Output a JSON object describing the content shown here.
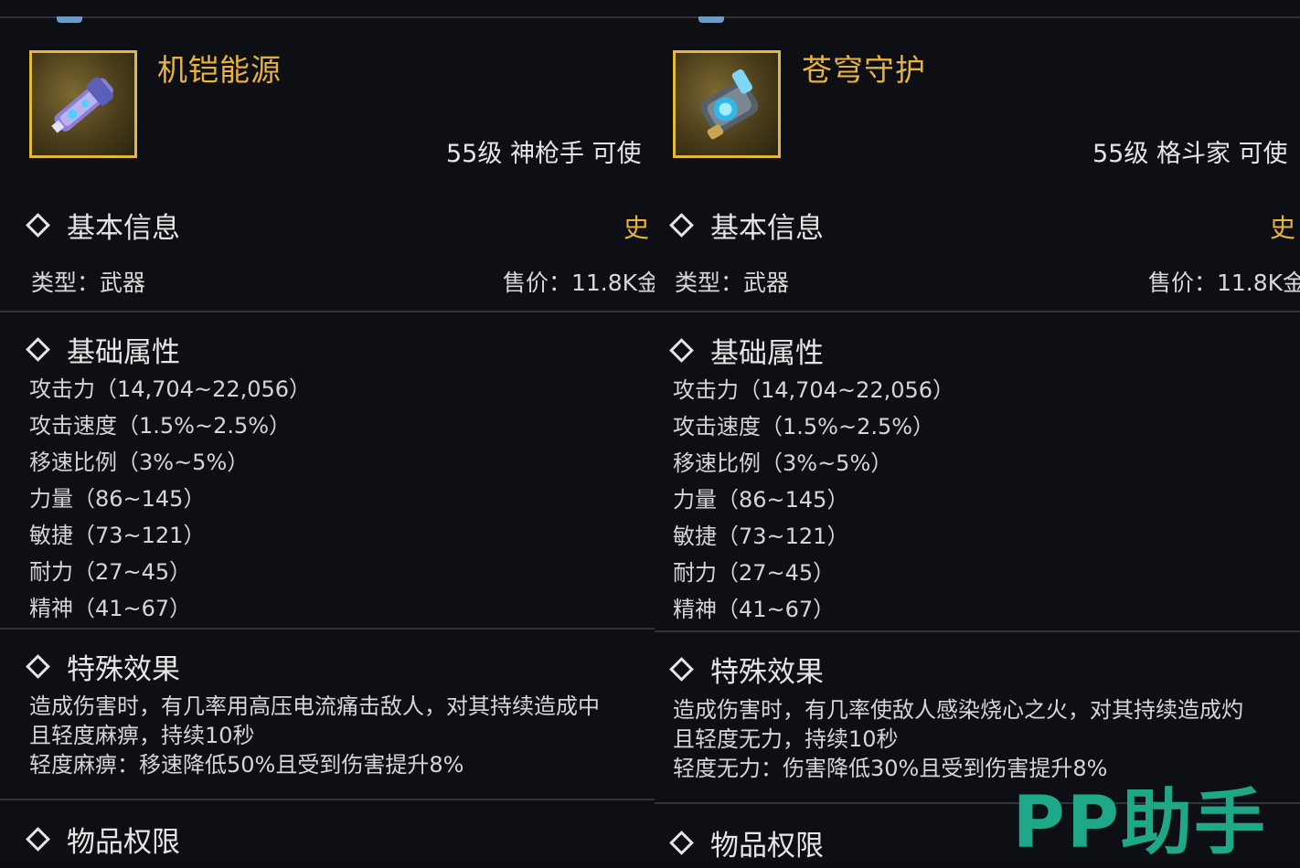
{
  "items": [
    {
      "name": "机铠能源",
      "requirement": "55级 神枪手 可使",
      "rarity": "史",
      "basic_info_title": "基本信息",
      "type_text": "类型：武器",
      "price_text": "售价：11.8K金",
      "attributes_title": "基础属性",
      "attributes": [
        "攻击力（14,704~22,056）",
        "攻击速度（1.5%~2.5%）",
        "移速比例（3%~5%）",
        "力量（86~145）",
        "敏捷（73~121）",
        "耐力（27~45）",
        "精神（41~67）"
      ],
      "effects_title": "特殊效果",
      "effect_lines": [
        "造成伤害时，有几率用高压电流痛击敌人，对其持续造成中",
        "且轻度麻痹，持续10秒",
        "轻度麻痹：移速降低50%且受到伤害提升8%"
      ],
      "permissions_title": "物品权限",
      "icon": "cannon-weapon-icon"
    },
    {
      "name": "苍穹守护",
      "requirement": "55级 格斗家 可使",
      "rarity": "史",
      "basic_info_title": "基本信息",
      "type_text": "类型：武器",
      "price_text": "售价：11.8K金",
      "attributes_title": "基础属性",
      "attributes": [
        "攻击力（14,704~22,056）",
        "攻击速度（1.5%~2.5%）",
        "移速比例（3%~5%）",
        "力量（86~145）",
        "敏捷（73~121）",
        "耐力（27~45）",
        "精神（41~67）"
      ],
      "effects_title": "特殊效果",
      "effect_lines": [
        "造成伤害时，有几率使敌人感染烧心之火，对其持续造成灼",
        "且轻度无力，持续10秒",
        "轻度无力：伤害降低30%且受到伤害提升8%"
      ],
      "permissions_title": "物品权限",
      "icon": "gauntlet-weapon-icon"
    }
  ],
  "watermark": "PP助手",
  "colors": {
    "rarity_gold": "#e8b23f",
    "frame_gold": "#e2b93d",
    "watermark_green": "#1fa888",
    "background": "#0d0f14"
  }
}
